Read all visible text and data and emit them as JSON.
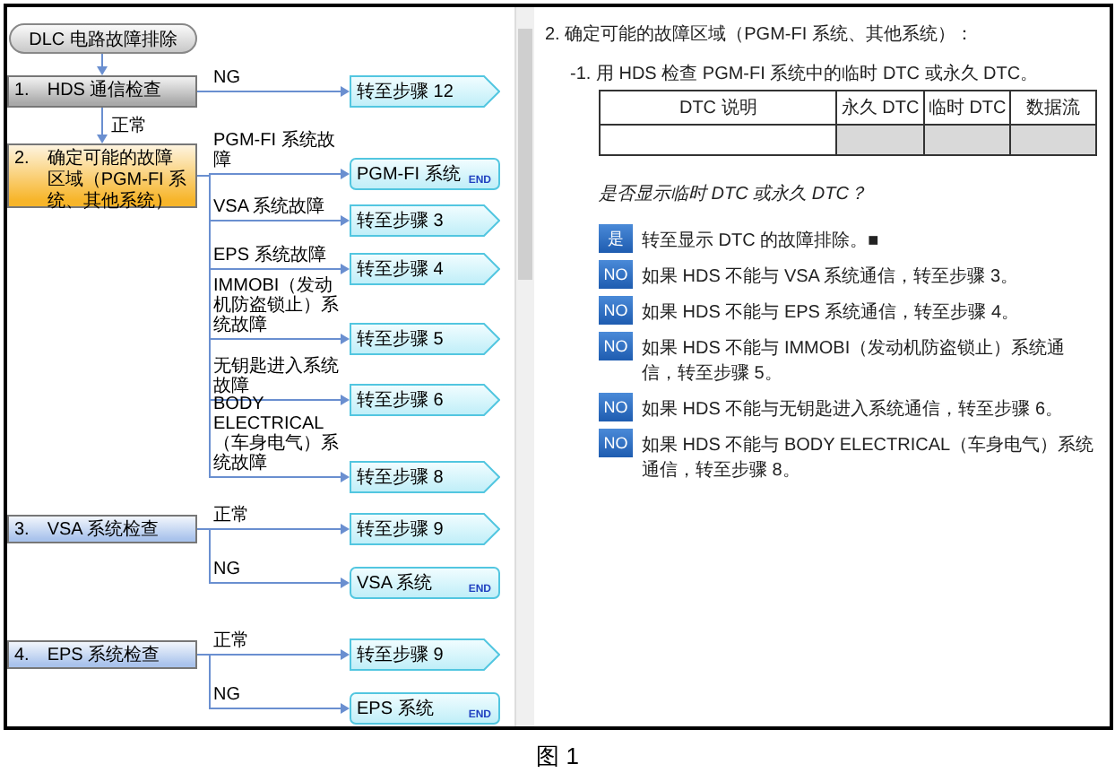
{
  "flowchart": {
    "title": "DLC 电路故障排除",
    "steps": [
      {
        "number": "1.",
        "label": "HDS 通信检查",
        "color": "#a9a9a9",
        "next_label": "正常",
        "branches": [
          {
            "condition": "NG",
            "target": "转至步骤 12",
            "kind": "goto"
          }
        ]
      },
      {
        "number": "2.",
        "label": "确定可能的故障区域（PGM-FI 系统、其他系统）",
        "color": "#f7b52a",
        "branches": [
          {
            "condition": "PGM-FI 系统故障",
            "target": "PGM-FI 系统",
            "kind": "end",
            "end_mark": "END"
          },
          {
            "condition": "VSA 系统故障",
            "target": "转至步骤 3",
            "kind": "goto"
          },
          {
            "condition": "EPS 系统故障",
            "target": "转至步骤 4",
            "kind": "goto"
          },
          {
            "condition": "IMMOBI（发动机防盗锁止）系统故障",
            "target": "转至步骤 5",
            "kind": "goto"
          },
          {
            "condition": "无钥匙进入系统故障",
            "target": "转至步骤 6",
            "kind": "goto"
          },
          {
            "condition": "BODY ELECTRICAL（车身电气）系统故障",
            "target": "转至步骤 8",
            "kind": "goto"
          }
        ]
      },
      {
        "number": "3.",
        "label": "VSA 系统检查",
        "color": "#a9c3ec",
        "branches": [
          {
            "condition": "正常",
            "target": "转至步骤 9",
            "kind": "goto"
          },
          {
            "condition": "NG",
            "target": "VSA 系统",
            "kind": "end",
            "end_mark": "END"
          }
        ]
      },
      {
        "number": "4.",
        "label": "EPS 系统检查",
        "color": "#a9c3ec",
        "branches": [
          {
            "condition": "正常",
            "target": "转至步骤 9",
            "kind": "goto"
          },
          {
            "condition": "NG",
            "target": "EPS 系统",
            "kind": "end",
            "end_mark": "END"
          }
        ]
      }
    ]
  },
  "content": {
    "heading": "2. 确定可能的故障区域（PGM-FI 系统、其他系统）：",
    "substep": "-1. 用 HDS 检查 PGM-FI 系统中的临时 DTC 或永久 DTC。",
    "table": {
      "columns": [
        "DTC 说明",
        "永久 DTC",
        "临时 DTC",
        "数据流"
      ]
    },
    "question": "是否显示临时 DTC 或永久 DTC？",
    "answers": [
      {
        "badge": "是",
        "text": "转至显示 DTC 的故障排除。■"
      },
      {
        "badge": "NO",
        "text": "如果 HDS 不能与 VSA 系统通信，转至步骤 3。"
      },
      {
        "badge": "NO",
        "text": "如果 HDS 不能与 EPS 系统通信，转至步骤 4。"
      },
      {
        "badge": "NO",
        "text": "如果 HDS 不能与 IMMOBI（发动机防盗锁止）系统通信，转至步骤 5。"
      },
      {
        "badge": "NO",
        "text": "如果 HDS 不能与无钥匙进入系统通信，转至步骤 6。"
      },
      {
        "badge": "NO",
        "text": "如果 HDS 不能与 BODY ELECTRICAL（车身电气）系统通信，转至步骤 8。"
      }
    ]
  },
  "caption": "图 1"
}
